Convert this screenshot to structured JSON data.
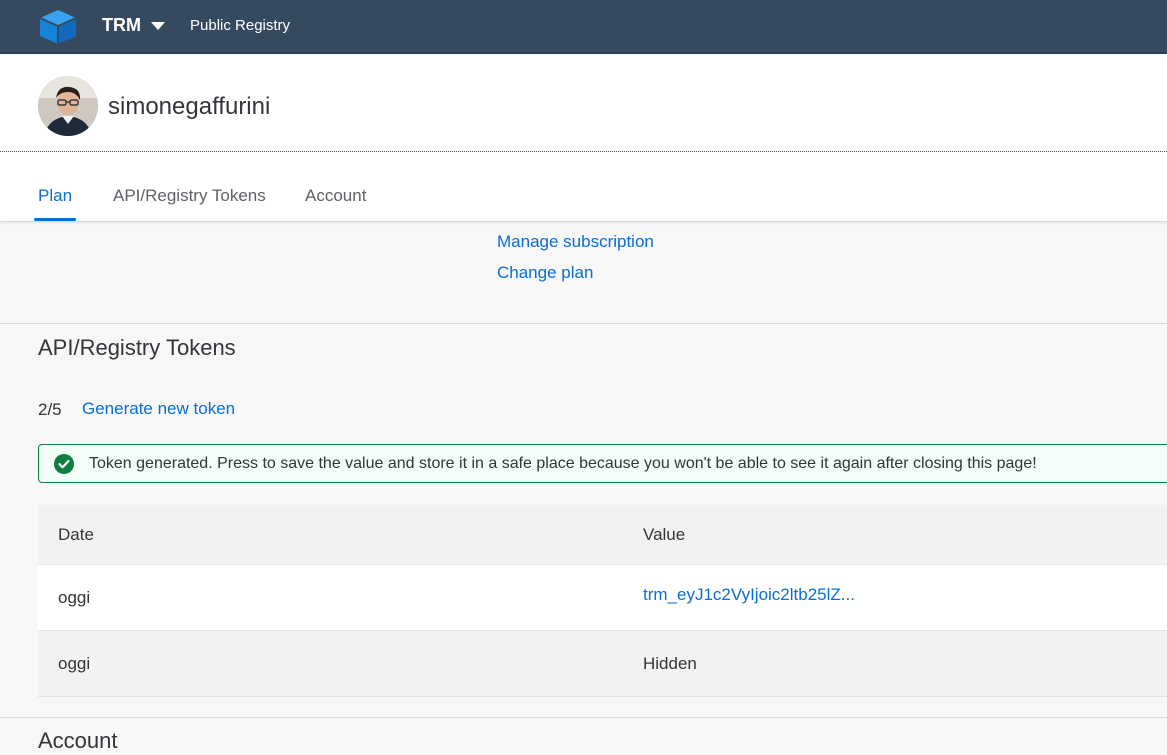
{
  "shell": {
    "app_name": "TRM",
    "registry": "Public Registry",
    "colors": {
      "bar": "#354a5f",
      "accent": "#0a6ed1"
    }
  },
  "profile": {
    "username": "simonegaffurini"
  },
  "tabs": [
    {
      "label": "Plan",
      "selected": true
    },
    {
      "label": "API/Registry Tokens",
      "selected": false
    },
    {
      "label": "Account",
      "selected": false
    }
  ],
  "plan": {
    "manage_subscription": "Manage subscription",
    "change_plan": "Change plan"
  },
  "tokens": {
    "title": "API/Registry Tokens",
    "count": "2/5",
    "generate": "Generate new token",
    "message": "Token generated. Press to save the value and store it in a safe place because you won't be able to see it again after closing this page!",
    "message_icon": "check-circle-icon",
    "columns": [
      "Date",
      "Value"
    ],
    "rows": [
      {
        "date": "oggi",
        "value": "trm_eyJ1c2VyIjoic2ltb25lZ...",
        "link": true
      },
      {
        "date": "oggi",
        "value": "Hidden",
        "link": false
      }
    ]
  },
  "account": {
    "title": "Account"
  }
}
